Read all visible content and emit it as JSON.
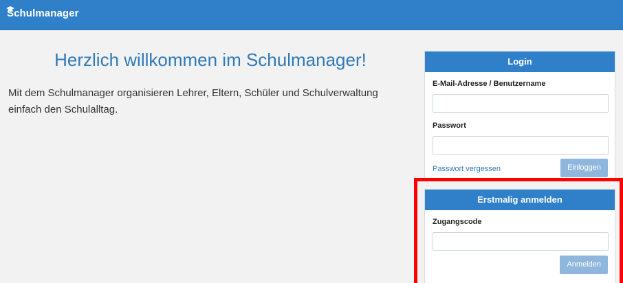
{
  "header": {
    "brand": "Schulmanager",
    "brand_icon": "graduation-cap-icon",
    "color": "#2f80c9"
  },
  "welcome": {
    "title": "Herzlich willkommen im Schulmanager!",
    "text": "Mit dem Schulmanager organisieren Lehrer, Eltern, Schüler und Schulverwaltung einfach den Schulalltag."
  },
  "login": {
    "title": "Login",
    "username_label": "E-Mail-Adresse / Benutzername",
    "username_value": "",
    "password_label": "Passwort",
    "password_value": "",
    "forgot_link": "Passwort vergessen",
    "submit_label": "Einloggen"
  },
  "register": {
    "title": "Erstmalig anmelden",
    "code_label": "Zugangscode",
    "code_value": "",
    "submit_label": "Anmelden"
  },
  "colors": {
    "accent": "#2f80c9",
    "button_disabled": "#8fb6dc",
    "highlight": "#ff0000"
  }
}
